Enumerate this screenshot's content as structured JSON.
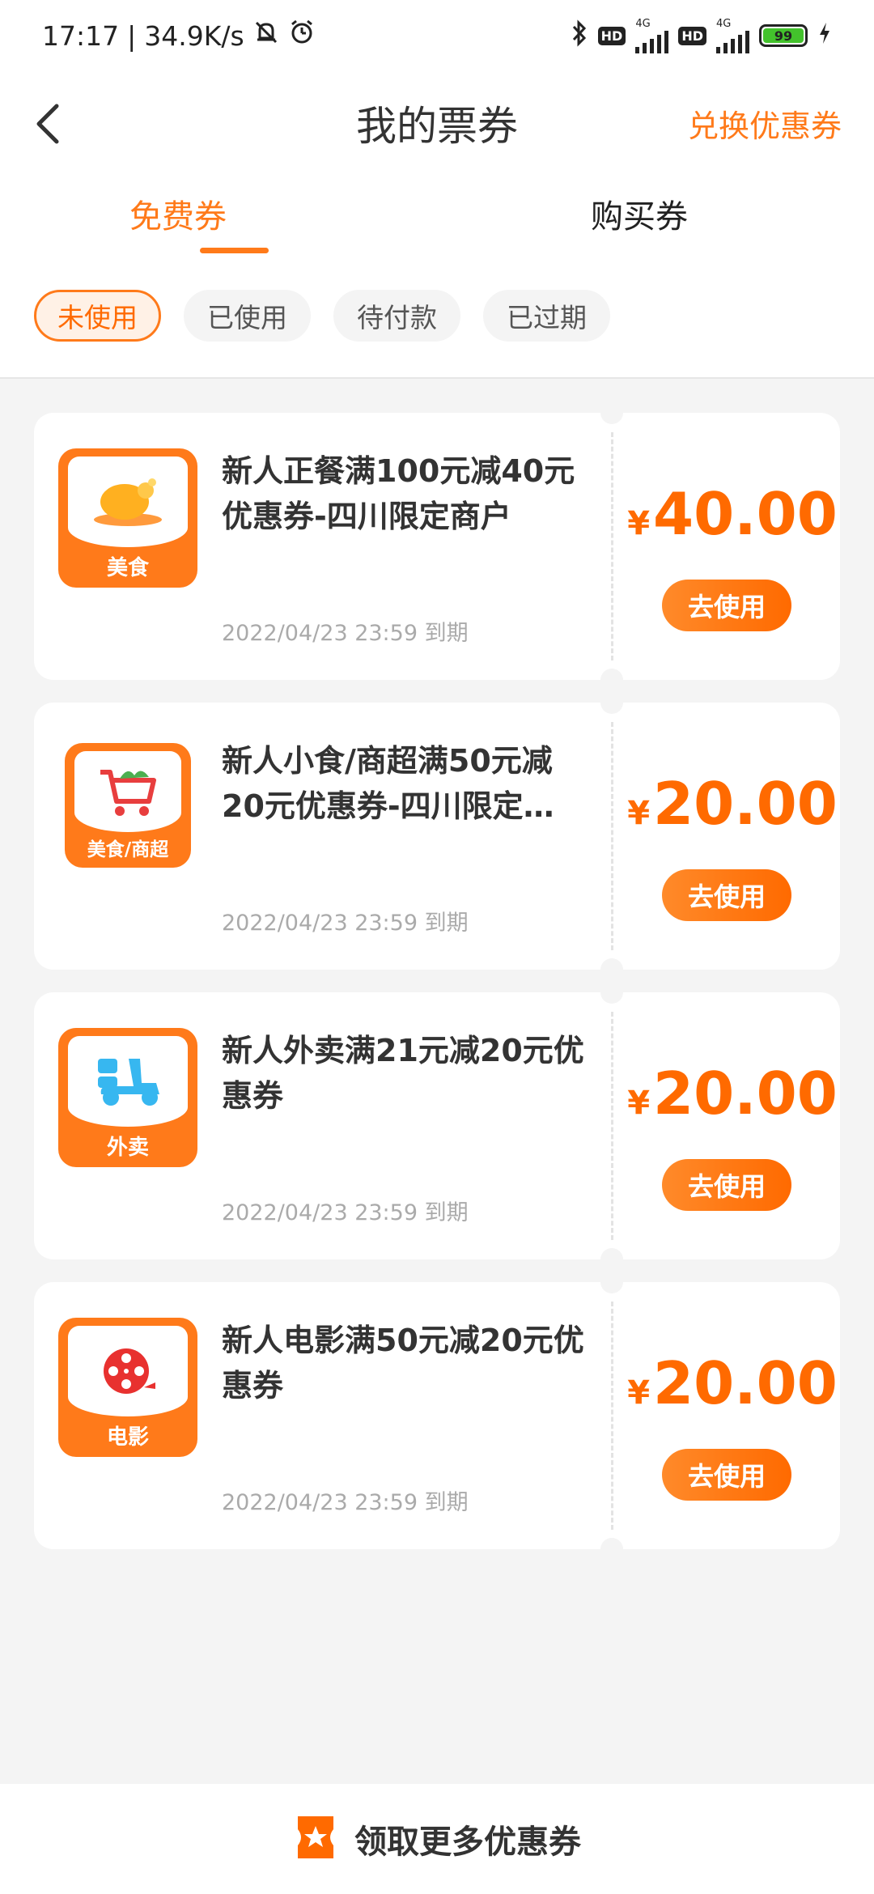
{
  "status_bar": {
    "time": "17:17",
    "network_speed": "34.9K/s",
    "battery_level": "99",
    "net_4g_1": "4G",
    "net_4g_2": "4G",
    "hd_1": "HD",
    "hd_2": "HD"
  },
  "header": {
    "title": "我的票券",
    "right_action": "兑换优惠券",
    "back_icon": "chevron-left-icon"
  },
  "tabs": [
    {
      "label": "免费券",
      "active": true
    },
    {
      "label": "购买券",
      "active": false
    }
  ],
  "filters": [
    {
      "label": "未使用",
      "active": true
    },
    {
      "label": "已使用",
      "active": false
    },
    {
      "label": "待付款",
      "active": false
    },
    {
      "label": "已过期",
      "active": false
    }
  ],
  "coupons": [
    {
      "category": "美食",
      "icon": "roast-chicken-icon",
      "title": "新人正餐满100元减40元优惠券-四川限定商户",
      "expire": "2022/04/23 23:59 到期",
      "currency": "¥",
      "amount": "40.00",
      "button": "去使用"
    },
    {
      "category": "美食/商超",
      "icon": "shopping-cart-icon",
      "title": "新人小食/商超满50元减20元优惠券-四川限定…",
      "expire": "2022/04/23 23:59 到期",
      "currency": "¥",
      "amount": "20.00",
      "button": "去使用"
    },
    {
      "category": "外卖",
      "icon": "scooter-icon",
      "title": "新人外卖满21元减20元优惠券",
      "expire": "2022/04/23 23:59 到期",
      "currency": "¥",
      "amount": "20.00",
      "button": "去使用"
    },
    {
      "category": "电影",
      "icon": "film-reel-icon",
      "title": "新人电影满50元减20元优惠券",
      "expire": "2022/04/23 23:59 到期",
      "currency": "¥",
      "amount": "20.00",
      "button": "去使用"
    }
  ],
  "bottom_bar": {
    "label": "领取更多优惠券",
    "icon": "ticket-star-icon"
  },
  "colors": {
    "accent": "#ff7a1a",
    "price": "#ff6a00",
    "background": "#f4f4f4"
  }
}
